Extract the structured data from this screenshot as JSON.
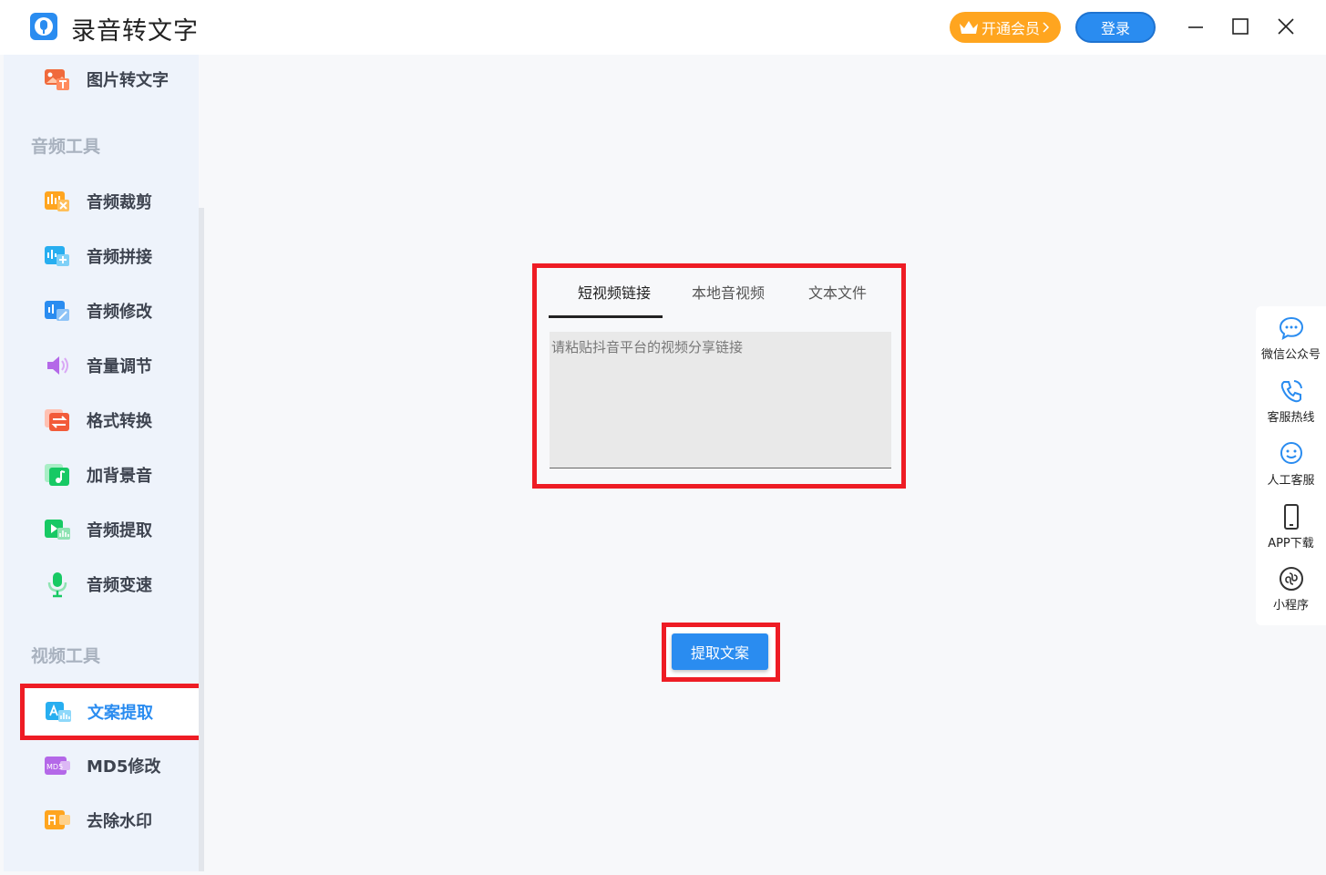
{
  "app": {
    "title": "录音转文字",
    "vip_label": "开通会员",
    "login_label": "登录"
  },
  "sidebar": {
    "top_item": "图片转文字",
    "audio_section": "音频工具",
    "audio_items": [
      "音频裁剪",
      "音频拼接",
      "音频修改",
      "音量调节",
      "格式转换",
      "加背景音",
      "音频提取",
      "音频变速"
    ],
    "video_section": "视频工具",
    "video_items": [
      "文案提取",
      "MD5修改",
      "去除水印"
    ],
    "active_item": "文案提取"
  },
  "main": {
    "tabs": [
      "短视频链接",
      "本地音视频",
      "文本文件"
    ],
    "active_tab": "短视频链接",
    "input_placeholder": "请粘贴抖音平台的视频分享链接",
    "input_value": "",
    "extract_label": "提取文案"
  },
  "float_bar": {
    "items": [
      "微信公众号",
      "客服热线",
      "人工客服",
      "APP下载",
      "小程序"
    ]
  },
  "colors": {
    "accent": "#2a8cf0",
    "vip": "#ffa51f",
    "highlight": "#ee1c24"
  }
}
